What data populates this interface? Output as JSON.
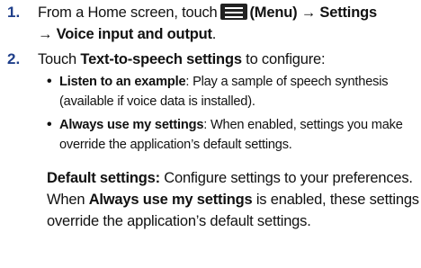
{
  "steps": [
    {
      "number": "1.",
      "line1_a": "From a Home screen, touch",
      "line1_b": "(Menu) → Settings",
      "line2": "→ Voice input and output",
      "line2_end": ".",
      "menu_icon": "menu-icon"
    },
    {
      "number": "2.",
      "touch": "Touch ",
      "tts": "Text-to-speech settings",
      "configure": " to configure:",
      "bullets": [
        {
          "term": "Listen to an example",
          "line1": ": Play a sample of speech synthesis",
          "line2": "(available if voice data is installed)."
        },
        {
          "term": "Always use my settings",
          "line1": ": When enabled, settings you make",
          "line2": "override the application’s default settings."
        }
      ],
      "default_term": "Default settings:",
      "default_line1": " Configure settings to your preferences.",
      "default_line2_a": "When ",
      "default_line2_term": "Always use my settings",
      "default_line2_b": " is enabled, these settings",
      "default_line3": "override the application’s default settings."
    }
  ]
}
